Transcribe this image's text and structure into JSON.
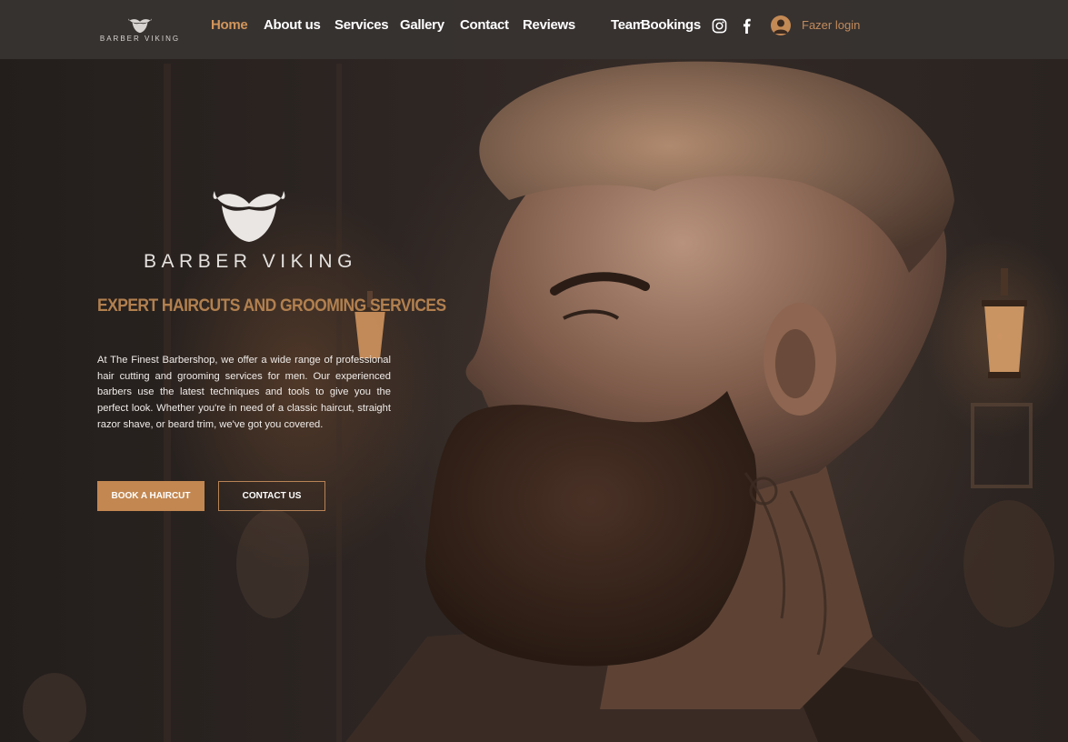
{
  "header": {
    "logo_text": "BARBER VIKING",
    "nav": [
      "Home",
      "About us",
      "Services",
      "Gallery",
      "Contact",
      "Reviews",
      "Team",
      "Bookings"
    ],
    "active_nav": "Home",
    "social_icons": [
      "instagram-icon",
      "facebook-icon"
    ],
    "login_label": "Fazer login"
  },
  "hero": {
    "brand_name": "BARBER VIKING",
    "tagline": "EXPERT HAIRCUTS AND GROOMING SERVICES",
    "intro": "At The Finest Barbershop, we offer a wide range of professional hair cutting and grooming services for men. Our experienced barbers use the latest techniques and tools to give you the perfect look. Whether you're in need of a classic haircut, straight razor shave, or beard trim, we've got you covered.",
    "book_button": "BOOK A HAIRCUT",
    "contact_button": "CONTACT US"
  },
  "colors": {
    "accent": "#c38751",
    "active_nav": "#d3955a",
    "header_bg": "#373331",
    "page_bg": "#2a2421",
    "tagline": "#b2804f"
  }
}
